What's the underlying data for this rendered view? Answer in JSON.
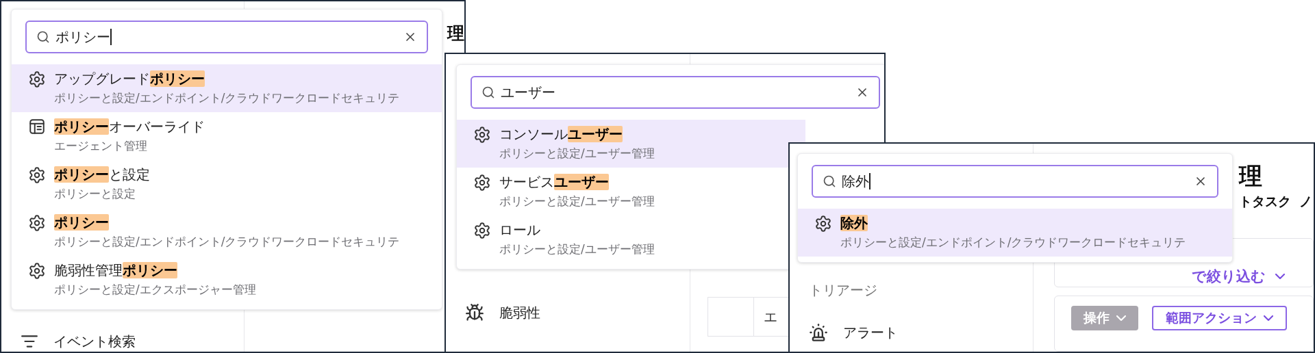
{
  "panels": [
    {
      "popup": {
        "query": "ポリシー",
        "caret": true,
        "results": [
          {
            "kind": "gear",
            "title": "アップグレード**ポリシー**",
            "path": "ポリシーと設定/エンドポイント/クラウドワークロードセキュリテ",
            "selected": true
          },
          {
            "kind": "layout",
            "title": "**ポリシー**オーバーライド",
            "path": "エージェント管理",
            "selected": false
          },
          {
            "kind": "gear",
            "title": "**ポリシー**と設定",
            "path": "ポリシーと設定",
            "selected": false
          },
          {
            "kind": "gear",
            "title": "**ポリシー**",
            "path": "ポリシーと設定/エンドポイント/クラウドワークロードセキュリテ",
            "selected": false
          },
          {
            "kind": "gear",
            "title": "脆弱性管理**ポリシー**",
            "path": "ポリシーと設定/エクスポージャー管理",
            "selected": false
          }
        ]
      },
      "backdrop": {
        "heading": "理",
        "sidebar": [
          {
            "kind": "list",
            "label": "イベント検索"
          }
        ]
      }
    },
    {
      "popup": {
        "query": "ユーザー",
        "results": [
          {
            "kind": "gear",
            "title": "コンソール**ユーザー**",
            "path": "ポリシーと設定/ユーザー管理",
            "selected": true
          },
          {
            "kind": "gear",
            "title": "サービス**ユーザー**",
            "path": "ポリシーと設定/ユーザー管理",
            "selected": false
          },
          {
            "kind": "gear",
            "title": "ロール",
            "path": "ポリシーと設定/ユーザー管理",
            "selected": false
          }
        ]
      },
      "backdrop": {
        "sidebar": [
          {
            "kind": "bug",
            "label": "脆弱性"
          }
        ],
        "table_header": [
          "エ"
        ]
      }
    },
    {
      "popup": {
        "query": "除外",
        "caret": true,
        "results": [
          {
            "kind": "gear",
            "title": "**除外**",
            "path": "ポリシーと設定/エンドポイント/クラウドワークロードセキュリテ",
            "selected": true
          }
        ]
      },
      "backdrop": {
        "heading": "理",
        "tabs": [
          "トタスク",
          "ノ"
        ],
        "sidebar": [
          {
            "kind": "plain",
            "label": "トリアージ"
          },
          {
            "kind": "siren",
            "label": "アラート"
          }
        ],
        "filter": "で絞り込む",
        "buttons": [
          {
            "label": "操作",
            "kind": "disabled"
          },
          {
            "label": "範囲アクション",
            "kind": "outline"
          }
        ]
      }
    }
  ]
}
